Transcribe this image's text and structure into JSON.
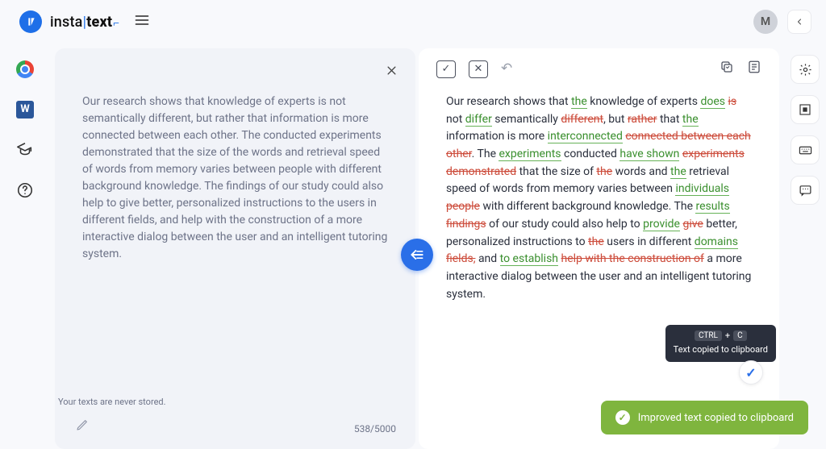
{
  "header": {
    "logo_insta": "insta",
    "logo_text": "text",
    "avatar_initial": "M"
  },
  "input": {
    "text": "Our research shows that knowledge of experts is not semantically different, but rather that information is more connected between each other. The conducted experiments demonstrated that the size of the words and retrieval speed of words from memory varies between people with different background knowledge. The findings of our study could also help to give better, personalized instructions to the users in different fields, and help with the construction of a more interactive dialog between the user and an intelligent tutoring system.",
    "char_count": "538/5000"
  },
  "output": {
    "tokens": [
      {
        "t": "Our research shows that ",
        "c": ""
      },
      {
        "t": "the",
        "c": "ins"
      },
      {
        "t": " knowledge of experts ",
        "c": ""
      },
      {
        "t": "does",
        "c": "ins"
      },
      {
        "t": " ",
        "c": ""
      },
      {
        "t": "is",
        "c": "del"
      },
      {
        "t": " not ",
        "c": ""
      },
      {
        "t": "differ",
        "c": "ins"
      },
      {
        "t": " semantically ",
        "c": ""
      },
      {
        "t": "different",
        "c": "del"
      },
      {
        "t": ", but ",
        "c": ""
      },
      {
        "t": "rather",
        "c": "del"
      },
      {
        "t": " that ",
        "c": ""
      },
      {
        "t": "the",
        "c": "ins"
      },
      {
        "t": " information is more ",
        "c": ""
      },
      {
        "t": "interconnected",
        "c": "ins"
      },
      {
        "t": " ",
        "c": ""
      },
      {
        "t": "connected between each other",
        "c": "del"
      },
      {
        "t": ". The ",
        "c": ""
      },
      {
        "t": "experiments",
        "c": "ins"
      },
      {
        "t": " conducted ",
        "c": ""
      },
      {
        "t": "have shown",
        "c": "ins"
      },
      {
        "t": " ",
        "c": ""
      },
      {
        "t": "experiments demonstrated",
        "c": "del"
      },
      {
        "t": " that the size of ",
        "c": ""
      },
      {
        "t": "the",
        "c": "del"
      },
      {
        "t": " words and ",
        "c": ""
      },
      {
        "t": "the",
        "c": "ins"
      },
      {
        "t": " retrieval speed of words from memory varies between ",
        "c": ""
      },
      {
        "t": "individuals",
        "c": "ins"
      },
      {
        "t": " ",
        "c": ""
      },
      {
        "t": "people",
        "c": "del"
      },
      {
        "t": " with different background knowledge. The ",
        "c": ""
      },
      {
        "t": "results",
        "c": "ins"
      },
      {
        "t": " ",
        "c": ""
      },
      {
        "t": "findings",
        "c": "del"
      },
      {
        "t": " of our study could also help to ",
        "c": ""
      },
      {
        "t": "provide",
        "c": "ins"
      },
      {
        "t": " ",
        "c": ""
      },
      {
        "t": "give",
        "c": "del"
      },
      {
        "t": " better, personalized instructions to ",
        "c": ""
      },
      {
        "t": "the",
        "c": "del"
      },
      {
        "t": " users in different ",
        "c": ""
      },
      {
        "t": "domains",
        "c": "ins"
      },
      {
        "t": " ",
        "c": ""
      },
      {
        "t": "fields,",
        "c": "del"
      },
      {
        "t": " and ",
        "c": ""
      },
      {
        "t": "to establish",
        "c": "ins"
      },
      {
        "t": " ",
        "c": ""
      },
      {
        "t": "help with the construction of",
        "c": "del"
      },
      {
        "t": " a more interactive dialog between the user and an intelligent tutoring system.",
        "c": ""
      }
    ]
  },
  "tooltip": {
    "key1": "CTRL",
    "plus": "+",
    "key2": "C",
    "text": "Text copied to clipboard"
  },
  "toast": {
    "text": "Improved text copied to clipboard"
  },
  "footer": {
    "note": "Your texts are never stored."
  }
}
